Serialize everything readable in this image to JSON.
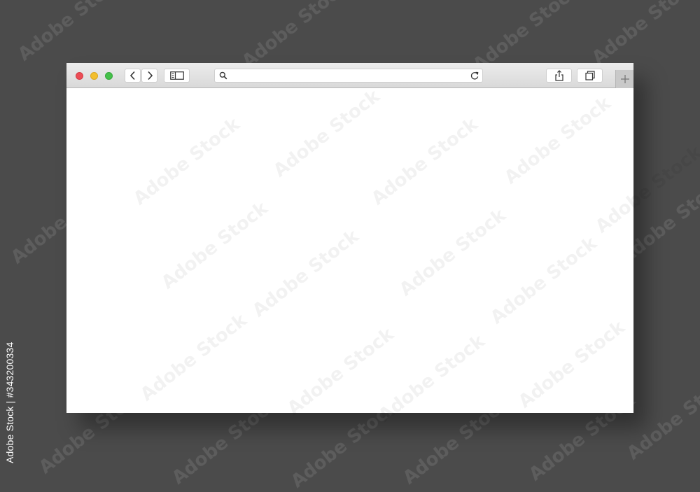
{
  "stock": {
    "watermark_text": "Adobe Stock",
    "side_id_text": "Adobe Stock | #343200334"
  },
  "browser": {
    "window_controls": [
      "close",
      "minimize",
      "maximize"
    ],
    "colors": {
      "close": "#ec4c55",
      "minimize": "#f3bf2e",
      "maximize": "#45c14a",
      "background": "#4b4b4b",
      "toolbar": "#e3e3e3",
      "content": "#ffffff"
    },
    "toolbar": {
      "back_icon": "chevron-left-icon",
      "forward_icon": "chevron-right-icon",
      "sidebar_icon": "sidebar-icon",
      "share_icon": "share-icon",
      "tabs_icon": "tabs-overview-icon",
      "new_tab_icon": "plus-icon"
    },
    "address_bar": {
      "value": "",
      "placeholder": "",
      "search_icon": "search-icon",
      "reload_icon": "reload-icon"
    },
    "content": {
      "text": ""
    }
  }
}
